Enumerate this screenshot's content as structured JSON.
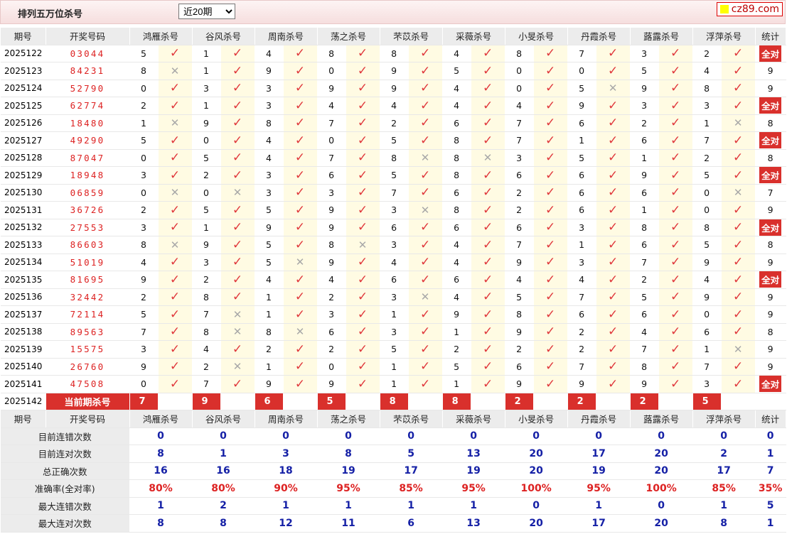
{
  "title": "排列五万位杀号",
  "period_select": "近20期",
  "logo_text": "cz89.com",
  "headers": [
    "期号",
    "开奖号码",
    "鸿雁杀号",
    "谷风杀号",
    "周南杀号",
    "荡之杀号",
    "芣苡杀号",
    "采薇杀号",
    "小旻杀号",
    "丹霞杀号",
    "蕗露杀号",
    "浮萍杀号",
    "统计"
  ],
  "rows": [
    {
      "period": "2025122",
      "number": "03044",
      "kills": [
        5,
        1,
        4,
        8,
        8,
        4,
        8,
        7,
        3,
        2
      ],
      "ok": [
        1,
        1,
        1,
        1,
        1,
        1,
        1,
        1,
        1,
        1
      ],
      "stat": "全对"
    },
    {
      "period": "2025123",
      "number": "84231",
      "kills": [
        8,
        1,
        9,
        0,
        9,
        5,
        0,
        0,
        5,
        4
      ],
      "ok": [
        0,
        1,
        1,
        1,
        1,
        1,
        1,
        1,
        1,
        1
      ],
      "stat": "9"
    },
    {
      "period": "2025124",
      "number": "52790",
      "kills": [
        0,
        3,
        3,
        9,
        9,
        4,
        0,
        5,
        9,
        8
      ],
      "ok": [
        1,
        1,
        1,
        1,
        1,
        1,
        1,
        0,
        1,
        1
      ],
      "stat": "9"
    },
    {
      "period": "2025125",
      "number": "62774",
      "kills": [
        2,
        1,
        3,
        4,
        4,
        4,
        4,
        9,
        3,
        3
      ],
      "ok": [
        1,
        1,
        1,
        1,
        1,
        1,
        1,
        1,
        1,
        1
      ],
      "stat": "全对"
    },
    {
      "period": "2025126",
      "number": "18480",
      "kills": [
        1,
        9,
        8,
        7,
        2,
        6,
        7,
        6,
        2,
        1
      ],
      "ok": [
        0,
        1,
        1,
        1,
        1,
        1,
        1,
        1,
        1,
        0
      ],
      "stat": "8"
    },
    {
      "period": "2025127",
      "number": "49290",
      "kills": [
        5,
        0,
        4,
        0,
        5,
        8,
        7,
        1,
        6,
        7
      ],
      "ok": [
        1,
        1,
        1,
        1,
        1,
        1,
        1,
        1,
        1,
        1
      ],
      "stat": "全对"
    },
    {
      "period": "2025128",
      "number": "87047",
      "kills": [
        0,
        5,
        4,
        7,
        8,
        8,
        3,
        5,
        1,
        2
      ],
      "ok": [
        1,
        1,
        1,
        1,
        0,
        0,
        1,
        1,
        1,
        1
      ],
      "stat": "8"
    },
    {
      "period": "2025129",
      "number": "18948",
      "kills": [
        3,
        2,
        3,
        6,
        5,
        8,
        6,
        6,
        9,
        5
      ],
      "ok": [
        1,
        1,
        1,
        1,
        1,
        1,
        1,
        1,
        1,
        1
      ],
      "stat": "全对"
    },
    {
      "period": "2025130",
      "number": "06859",
      "kills": [
        0,
        0,
        3,
        3,
        7,
        6,
        2,
        6,
        6,
        0
      ],
      "ok": [
        0,
        0,
        1,
        1,
        1,
        1,
        1,
        1,
        1,
        0
      ],
      "stat": "7"
    },
    {
      "period": "2025131",
      "number": "36726",
      "kills": [
        2,
        5,
        5,
        9,
        3,
        8,
        2,
        6,
        1,
        0
      ],
      "ok": [
        1,
        1,
        1,
        1,
        0,
        1,
        1,
        1,
        1,
        1
      ],
      "stat": "9"
    },
    {
      "period": "2025132",
      "number": "27553",
      "kills": [
        3,
        1,
        9,
        9,
        6,
        6,
        6,
        3,
        8,
        8
      ],
      "ok": [
        1,
        1,
        1,
        1,
        1,
        1,
        1,
        1,
        1,
        1
      ],
      "stat": "全对"
    },
    {
      "period": "2025133",
      "number": "86603",
      "kills": [
        8,
        9,
        5,
        8,
        3,
        4,
        7,
        1,
        6,
        5
      ],
      "ok": [
        0,
        1,
        1,
        0,
        1,
        1,
        1,
        1,
        1,
        1
      ],
      "stat": "8"
    },
    {
      "period": "2025134",
      "number": "51019",
      "kills": [
        4,
        3,
        5,
        9,
        4,
        4,
        9,
        3,
        7,
        9
      ],
      "ok": [
        1,
        1,
        0,
        1,
        1,
        1,
        1,
        1,
        1,
        1
      ],
      "stat": "9"
    },
    {
      "period": "2025135",
      "number": "81695",
      "kills": [
        9,
        2,
        4,
        4,
        6,
        6,
        4,
        4,
        2,
        4
      ],
      "ok": [
        1,
        1,
        1,
        1,
        1,
        1,
        1,
        1,
        1,
        1
      ],
      "stat": "全对"
    },
    {
      "period": "2025136",
      "number": "32442",
      "kills": [
        2,
        8,
        1,
        2,
        3,
        4,
        5,
        7,
        5,
        9
      ],
      "ok": [
        1,
        1,
        1,
        1,
        0,
        1,
        1,
        1,
        1,
        1
      ],
      "stat": "9"
    },
    {
      "period": "2025137",
      "number": "72114",
      "kills": [
        5,
        7,
        1,
        3,
        1,
        9,
        8,
        6,
        6,
        0
      ],
      "ok": [
        1,
        0,
        1,
        1,
        1,
        1,
        1,
        1,
        1,
        1
      ],
      "stat": "9"
    },
    {
      "period": "2025138",
      "number": "89563",
      "kills": [
        7,
        8,
        8,
        6,
        3,
        1,
        9,
        2,
        4,
        6
      ],
      "ok": [
        1,
        0,
        0,
        1,
        1,
        1,
        1,
        1,
        1,
        1
      ],
      "stat": "8"
    },
    {
      "period": "2025139",
      "number": "15575",
      "kills": [
        3,
        4,
        2,
        2,
        5,
        2,
        2,
        2,
        7,
        1
      ],
      "ok": [
        1,
        1,
        1,
        1,
        1,
        1,
        1,
        1,
        1,
        0
      ],
      "stat": "9"
    },
    {
      "period": "2025140",
      "number": "26760",
      "kills": [
        9,
        2,
        1,
        0,
        1,
        5,
        6,
        7,
        8,
        7
      ],
      "ok": [
        1,
        0,
        1,
        1,
        1,
        1,
        1,
        1,
        1,
        1
      ],
      "stat": "9"
    },
    {
      "period": "2025141",
      "number": "47508",
      "kills": [
        0,
        7,
        9,
        9,
        1,
        1,
        9,
        9,
        9,
        3
      ],
      "ok": [
        1,
        1,
        1,
        1,
        1,
        1,
        1,
        1,
        1,
        1
      ],
      "stat": "全对"
    }
  ],
  "current": {
    "period": "2025142",
    "label": "当前期杀号",
    "kills": [
      7,
      9,
      6,
      5,
      8,
      8,
      2,
      2,
      2,
      5
    ]
  },
  "stats": [
    {
      "label": "目前连错次数",
      "values": [
        "0",
        "0",
        "0",
        "0",
        "0",
        "0",
        "0",
        "0",
        "0",
        "0",
        "0"
      ]
    },
    {
      "label": "目前连对次数",
      "values": [
        "8",
        "1",
        "3",
        "8",
        "5",
        "13",
        "20",
        "17",
        "20",
        "2",
        "1"
      ]
    },
    {
      "label": "总正确次数",
      "values": [
        "16",
        "16",
        "18",
        "19",
        "17",
        "19",
        "20",
        "19",
        "20",
        "17",
        "7"
      ]
    },
    {
      "label": "准确率(全对率)",
      "values": [
        "80%",
        "80%",
        "90%",
        "95%",
        "85%",
        "95%",
        "100%",
        "95%",
        "100%",
        "85%",
        "35%"
      ],
      "pct": true
    },
    {
      "label": "最大连错次数",
      "values": [
        "1",
        "2",
        "1",
        "1",
        "1",
        "1",
        "0",
        "1",
        "0",
        "1",
        "5"
      ]
    },
    {
      "label": "最大连对次数",
      "values": [
        "8",
        "8",
        "12",
        "11",
        "6",
        "13",
        "20",
        "17",
        "20",
        "8",
        "1"
      ]
    }
  ],
  "icons": {
    "correct": "check-mark-icon",
    "wrong": "cross-mark-icon"
  }
}
